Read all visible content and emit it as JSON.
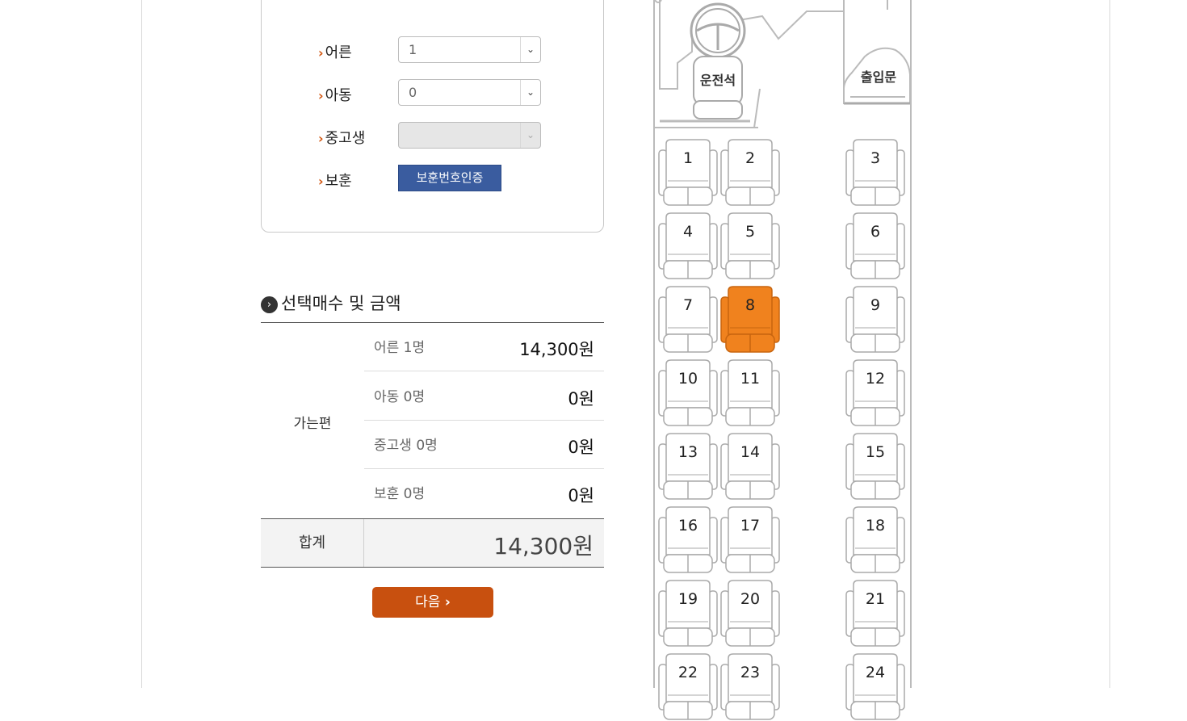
{
  "passengers": [
    {
      "label": "어른",
      "type": "select",
      "value": "1",
      "disabled": false
    },
    {
      "label": "아동",
      "type": "select",
      "value": "0",
      "disabled": false
    },
    {
      "label": "중고생",
      "type": "select",
      "value": "",
      "disabled": true
    },
    {
      "label": "보훈",
      "type": "button",
      "button_label": "보훈번호인증"
    }
  ],
  "fare_section": {
    "title": "선택매수 및 금액",
    "direction": "가는편",
    "rows": [
      {
        "label": "어른 1명",
        "amount": "14,300원"
      },
      {
        "label": "아동 0명",
        "amount": "0원"
      },
      {
        "label": "중고생 0명",
        "amount": "0원"
      },
      {
        "label": "보훈 0명",
        "amount": "0원"
      }
    ],
    "total_label": "합계",
    "total_value": "14,300원"
  },
  "next_button": "다음",
  "bus": {
    "driver_label": "운전석",
    "door_label": "출입문",
    "seats": [
      "1",
      "2",
      "3",
      "4",
      "5",
      "6",
      "7",
      "8",
      "9",
      "10",
      "11",
      "12",
      "13",
      "14",
      "15",
      "16",
      "17",
      "18",
      "19",
      "20",
      "21",
      "22",
      "23",
      "24"
    ],
    "selected_seat": "8",
    "selected_color": "#f0821e"
  }
}
